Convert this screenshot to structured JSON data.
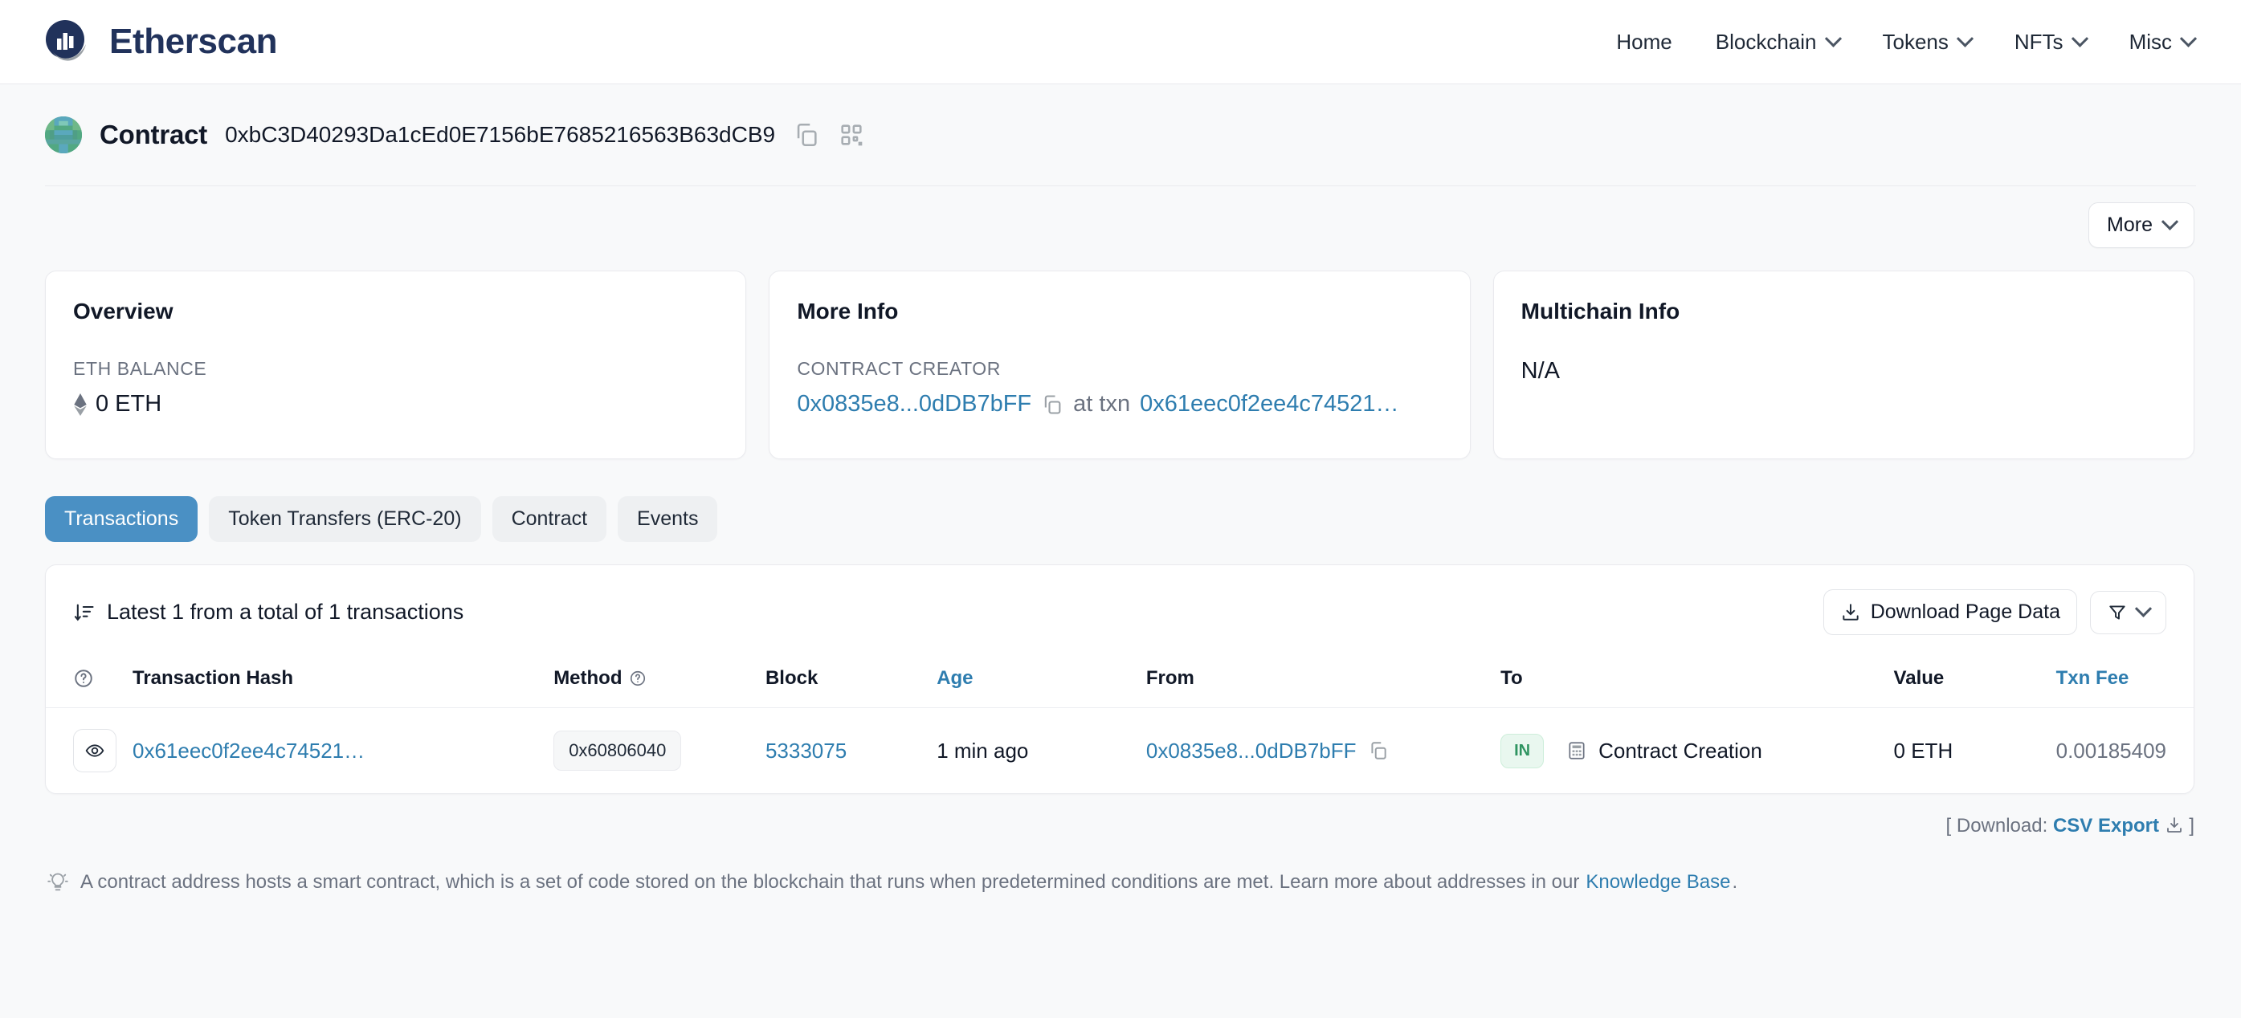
{
  "header": {
    "brand": "Etherscan",
    "logo_icon": "etherscan-logo-icon",
    "nav": [
      {
        "label": "Home",
        "has_dropdown": false
      },
      {
        "label": "Blockchain",
        "has_dropdown": true
      },
      {
        "label": "Tokens",
        "has_dropdown": true
      },
      {
        "label": "NFTs",
        "has_dropdown": true
      },
      {
        "label": "Misc",
        "has_dropdown": true
      }
    ]
  },
  "address_header": {
    "type_label": "Contract",
    "address": "0xbC3D40293Da1cEd0E7156bE7685216563B63dCB9",
    "copy_icon": "copy-icon",
    "qr_icon": "qr-code-icon",
    "avatar_icon": "address-blockie-avatar"
  },
  "toolbar": {
    "more_label": "More",
    "chevron_icon": "chevron-down-icon"
  },
  "cards": {
    "overview": {
      "title": "Overview",
      "balance_label": "ETH BALANCE",
      "balance_value": "0 ETH",
      "eth_icon": "ethereum-diamond-icon"
    },
    "more_info": {
      "title": "More Info",
      "creator_label": "CONTRACT CREATOR",
      "creator_address": "0x0835e8...0dDB7bFF",
      "at_txn_label": "at txn",
      "creation_txn": "0x61eec0f2ee4c74521…",
      "copy_icon": "copy-icon"
    },
    "multichain": {
      "title": "Multichain Info",
      "value": "N/A"
    }
  },
  "tabs": [
    {
      "label": "Transactions",
      "active": true
    },
    {
      "label": "Token Transfers (ERC-20)",
      "active": false
    },
    {
      "label": "Contract",
      "active": false
    },
    {
      "label": "Events",
      "active": false
    }
  ],
  "txn_panel": {
    "summary": "Latest 1 from a total of 1 transactions",
    "sort_icon": "sort-descending-icon",
    "download_label": "Download Page Data",
    "download_icon": "download-icon",
    "filter_icon": "funnel-filter-icon",
    "filter_chevron_icon": "chevron-down-icon",
    "columns": [
      {
        "label": "",
        "icon": "question-circle-icon",
        "sortable": false
      },
      {
        "label": "Transaction Hash",
        "sortable": false
      },
      {
        "label": "Method",
        "icon": "question-circle-icon",
        "sortable": false
      },
      {
        "label": "Block",
        "sortable": false
      },
      {
        "label": "Age",
        "sortable": true
      },
      {
        "label": "From",
        "sortable": false
      },
      {
        "label": "To",
        "sortable": false
      },
      {
        "label": "Value",
        "sortable": false
      },
      {
        "label": "Txn Fee",
        "sortable": true
      }
    ],
    "rows": [
      {
        "eye_icon": "eye-preview-icon",
        "hash": "0x61eec0f2ee4c74521…",
        "method": "0x60806040",
        "block": "5333075",
        "age": "1 min ago",
        "from": "0x0835e8...0dDB7bFF",
        "from_copy_icon": "copy-icon",
        "direction_badge": "IN",
        "to_icon": "contract-icon",
        "to": "Contract Creation",
        "value": "0 ETH",
        "txn_fee": "0.00185409"
      }
    ],
    "csv_prefix": "[ Download:",
    "csv_label": "CSV Export",
    "csv_icon": "download-icon",
    "csv_suffix": "]"
  },
  "footer_hint": {
    "icon": "lightbulb-icon",
    "text": "A contract address hosts a smart contract, which is a set of code stored on the blockchain that runs when predetermined conditions are met. Learn more about addresses in our",
    "link_label": "Knowledge Base",
    "period": "."
  },
  "colors": {
    "brand_navy": "#21325b",
    "link_blue": "#2e7daf",
    "tab_active": "#4a90c4",
    "badge_in_text": "#2f9461",
    "badge_in_bg": "#e9f7ef",
    "page_bg": "#f8f9fa"
  }
}
